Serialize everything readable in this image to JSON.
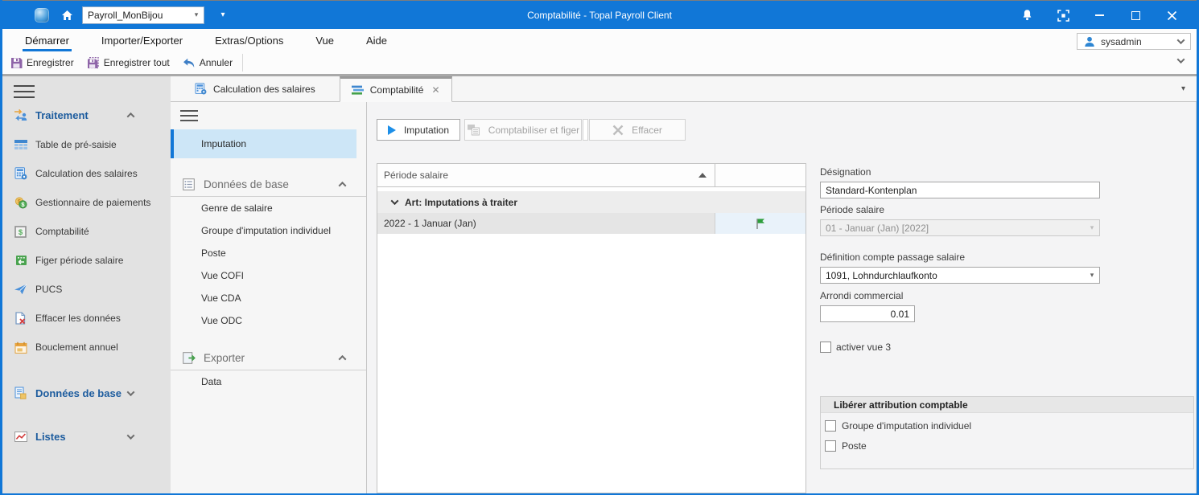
{
  "titlebar": {
    "app_title": "Comptabilité - Topal Payroll Client",
    "mandant_selector": "Payroll_MonBijou"
  },
  "menubar": {
    "items": [
      "Démarrer",
      "Importer/Exporter",
      "Extras/Options",
      "Vue",
      "Aide"
    ],
    "active_item": "Démarrer",
    "user": "sysadmin"
  },
  "toolbar": {
    "save": "Enregistrer",
    "save_all": "Enregistrer tout",
    "undo": "Annuler"
  },
  "sidebar": {
    "sections": {
      "traitement": "Traitement",
      "donnees_de_base": "Données de base",
      "listes": "Listes"
    },
    "traitement_items": [
      "Table de pré-saisie",
      "Calculation des salaires",
      "Gestionnaire de paiements",
      "Comptabilité",
      "Figer période salaire",
      "PUCS",
      "Effacer les données",
      "Bouclement annuel"
    ]
  },
  "tabs": {
    "items": [
      "Calculation des salaires",
      "Comptabilité"
    ],
    "active": "Comptabilité"
  },
  "subnav": {
    "selected_item": "Imputation",
    "sections": [
      {
        "label": "Données de base",
        "items": [
          "Genre de salaire",
          "Groupe d'imputation individuel",
          "Poste",
          "Vue COFI",
          "Vue CDA",
          "Vue ODC"
        ]
      },
      {
        "label": "Exporter",
        "items": [
          "Data"
        ]
      }
    ]
  },
  "main": {
    "buttons": [
      "Imputation",
      "Comptabiliser et figer",
      "Effacer"
    ],
    "table": {
      "column_header": "Période salaire",
      "sort": "ascending",
      "group_row": "Art: Imputations à traiter",
      "rows": [
        "2022 - 1 Januar (Jan)"
      ]
    }
  },
  "details": {
    "designation": {
      "label": "Désignation",
      "value": "Standard-Kontenplan"
    },
    "periode_salaire": {
      "label": "Période salaire",
      "value": "01 - Januar (Jan) [2022]"
    },
    "compte_passage": {
      "label": "Définition compte passage salaire",
      "value": "1091, Lohndurchlaufkonto"
    },
    "arrondi": {
      "label": "Arrondi commercial",
      "value": "0.01"
    },
    "activer_vue3": {
      "label": "activer vue 3",
      "checked": false
    },
    "liberer": {
      "title": "Libérer attribution comptable",
      "options": [
        "Groupe d'imputation individuel",
        "Poste"
      ]
    }
  },
  "colors": {
    "titlebar_blue": "#1177d7",
    "accent_blue": "#1177d7",
    "selection_blue": "#cde6f7",
    "section_text_blue": "#1d5c9e"
  }
}
